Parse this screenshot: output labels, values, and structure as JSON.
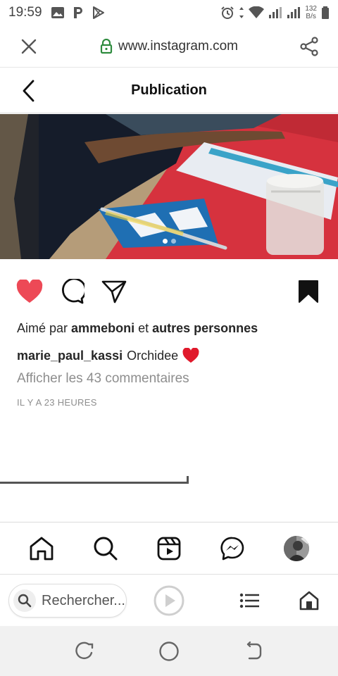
{
  "status_bar": {
    "time": "19:59",
    "net_speed_value": "132",
    "net_speed_unit": "B/s"
  },
  "browser": {
    "url": "www.instagram.com",
    "search_placeholder": "Rechercher..."
  },
  "header": {
    "title": "Publication"
  },
  "post": {
    "likes_prefix": "Aimé par",
    "liked_by_user": "ammeboni",
    "likes_connector": "et",
    "likes_others": "autres personnes",
    "author": "marie_paul_kassi",
    "caption_text": "Orchidee",
    "comments_link": "Afficher les 43 commentaires",
    "timestamp": "IL Y A 23 HEURES",
    "carousel_dots": 2,
    "active_dot": 0,
    "liked": true,
    "saved": true
  },
  "colors": {
    "like_red": "#ed4956",
    "text_dark": "#262626",
    "text_muted": "#8e8e8e",
    "secure_green": "#2e8b3e"
  }
}
